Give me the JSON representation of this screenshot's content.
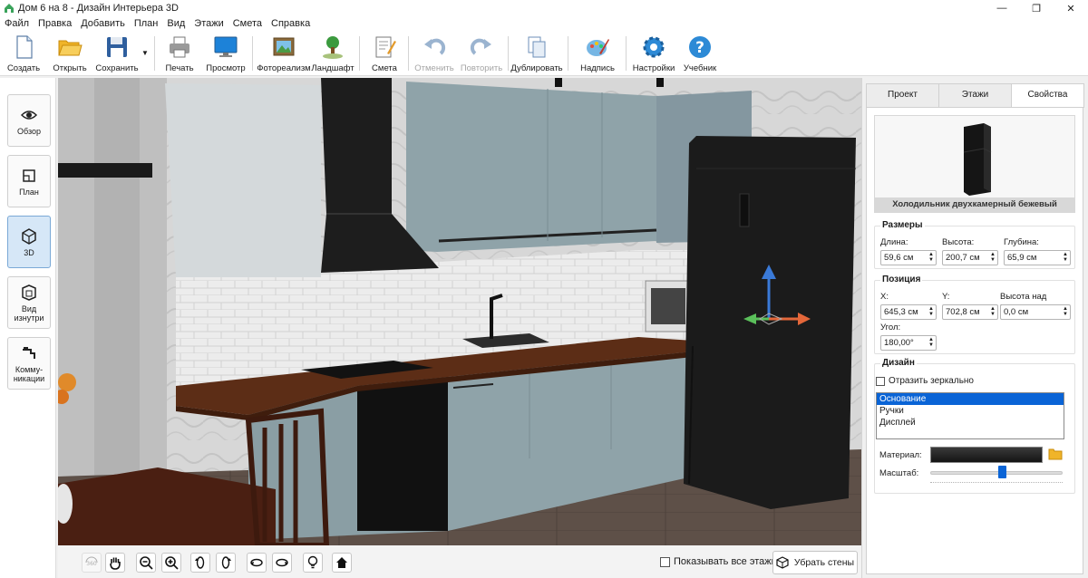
{
  "window": {
    "title": "Дом 6 на 8 - Дизайн Интерьера 3D",
    "minimize": "—",
    "maximize": "❐",
    "close": "✕"
  },
  "menu": [
    "Файл",
    "Правка",
    "Добавить",
    "План",
    "Вид",
    "Этажи",
    "Смета",
    "Справка"
  ],
  "toolbar": {
    "create": "Создать",
    "open": "Открыть",
    "save": "Сохранить",
    "print": "Печать",
    "preview": "Просмотр",
    "photorealism": "Фотореализм",
    "landscape": "Ландшафт",
    "estimate": "Смета",
    "undo": "Отменить",
    "redo": "Повторить",
    "duplicate": "Дублировать",
    "label": "Надпись",
    "settings": "Настройки",
    "tutorial": "Учебник"
  },
  "sidebar": {
    "overview": "Обзор",
    "plan": "План",
    "view3d": "3D",
    "inside": [
      "Вид",
      "изнутри"
    ],
    "utilities": [
      "Комму-",
      "никации"
    ]
  },
  "bottom": {
    "show_all_floors": "Показывать все этажи",
    "remove_walls": "Убрать стены",
    "icon_360": "360"
  },
  "panel": {
    "tabs": [
      "Проект",
      "Этажи",
      "Свойства"
    ],
    "object_name": "Холодильник двухкамерный бежевый",
    "dimensions": {
      "title": "Размеры",
      "length_label": "Длина:",
      "length": "59,6 см",
      "height_label": "Высота:",
      "height": "200,7 см",
      "depth_label": "Глубина:",
      "depth": "65,9 см"
    },
    "position": {
      "title": "Позиция",
      "x_label": "X:",
      "x": "645,3 см",
      "y_label": "Y:",
      "y": "702,8 см",
      "elev_label": "Высота над полом:",
      "elev": "0,0 см",
      "angle_label": "Угол:",
      "angle": "180,00°"
    },
    "design": {
      "title": "Дизайн",
      "mirror": "Отразить зеркально",
      "parts": [
        "Основание",
        "Ручки",
        "Дисплей"
      ],
      "material_label": "Материал:",
      "scale_label": "Масштаб:",
      "scale_value": 0.55
    }
  },
  "colors": {
    "accent": "#0a64d6",
    "cabinet": "#8a9ea4",
    "countertop": "#5c2d16",
    "appliance": "#1a1a1a",
    "floor": "#5b4d44"
  }
}
